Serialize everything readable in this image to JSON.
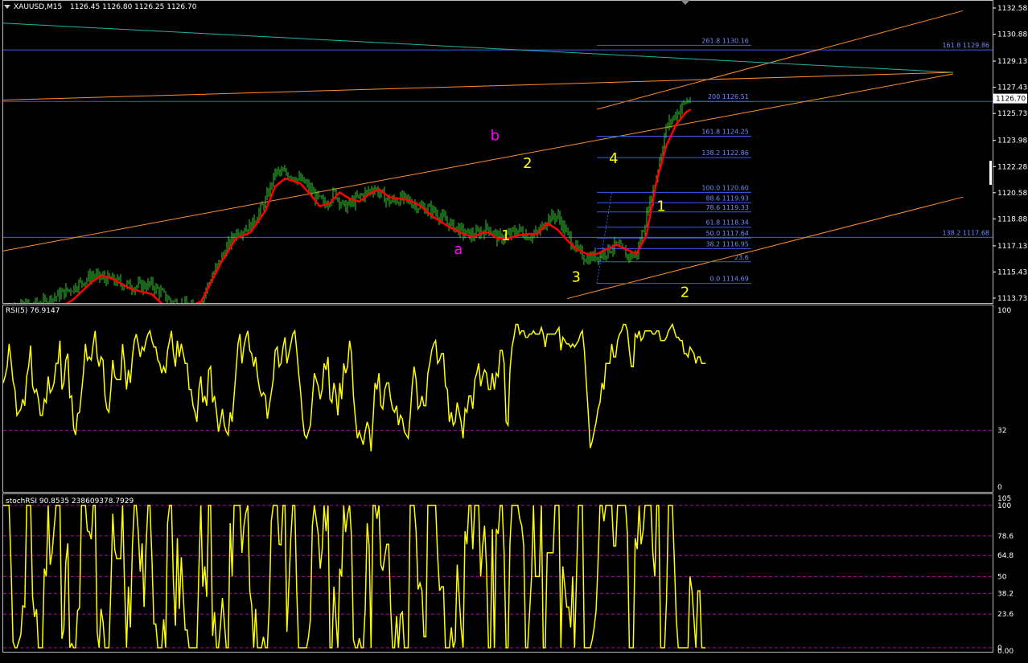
{
  "header": {
    "symbol_timeframe": "XAUUSD,M15",
    "ohlc": "1126.45 1126.80 1126.25 1126.70"
  },
  "colors": {
    "background": "#000000",
    "candles": "#32cd32",
    "ma": "#ff0000",
    "fib_levels": "#3b5bff",
    "trend_lines": "#ff8c2a",
    "channel_line": "#20b2aa",
    "rsi": "#ffff00",
    "wave_labels": "#ffff00",
    "abc_labels": "#ff00ff",
    "separator": "#ffffff",
    "level_lines": "#b000b0"
  },
  "chart_data": [
    {
      "type": "candlestick",
      "title": "XAUUSD,M15",
      "ylim": [
        1113.73,
        1132.58
      ],
      "y_ticks": [
        "1132.58",
        "1130.88",
        "1129.13",
        "1127.43",
        "1125.73",
        "1123.98",
        "1122.28",
        "1120.58",
        "1118.88",
        "1117.13",
        "1115.43",
        "1113.73"
      ],
      "current_price": "1126.70",
      "close_path": [
        [
          0.0,
          1113.0
        ],
        [
          0.04,
          1113.4
        ],
        [
          0.07,
          1114.4
        ],
        [
          0.09,
          1115.2
        ],
        [
          0.11,
          1114.9
        ],
        [
          0.13,
          1114.5
        ],
        [
          0.15,
          1114.6
        ],
        [
          0.17,
          1113.5
        ],
        [
          0.195,
          1113.0
        ],
        [
          0.205,
          1114.3
        ],
        [
          0.22,
          1116.3
        ],
        [
          0.235,
          1118.0
        ],
        [
          0.25,
          1118.4
        ],
        [
          0.265,
          1120.0
        ],
        [
          0.275,
          1121.9
        ],
        [
          0.29,
          1121.8
        ],
        [
          0.305,
          1121.2
        ],
        [
          0.315,
          1120.4
        ],
        [
          0.325,
          1119.8
        ],
        [
          0.335,
          1120.6
        ],
        [
          0.345,
          1119.6
        ],
        [
          0.36,
          1120.3
        ],
        [
          0.375,
          1120.9
        ],
        [
          0.39,
          1120.0
        ],
        [
          0.405,
          1120.2
        ],
        [
          0.42,
          1119.7
        ],
        [
          0.435,
          1119.4
        ],
        [
          0.45,
          1118.6
        ],
        [
          0.465,
          1118.0
        ],
        [
          0.475,
          1117.8
        ],
        [
          0.485,
          1118.1
        ],
        [
          0.49,
          1118.4
        ],
        [
          0.5,
          1117.6
        ],
        [
          0.51,
          1117.8
        ],
        [
          0.52,
          1118.2
        ],
        [
          0.53,
          1117.8
        ],
        [
          0.54,
          1117.9
        ],
        [
          0.55,
          1118.9
        ],
        [
          0.56,
          1119.1
        ],
        [
          0.57,
          1117.9
        ],
        [
          0.58,
          1116.8
        ],
        [
          0.59,
          1116.3
        ],
        [
          0.605,
          1116.6
        ],
        [
          0.62,
          1117.2
        ],
        [
          0.63,
          1116.5
        ],
        [
          0.64,
          1116.5
        ],
        [
          0.65,
          1119.0
        ],
        [
          0.66,
          1121.6
        ],
        [
          0.67,
          1124.8
        ],
        [
          0.68,
          1125.7
        ],
        [
          0.69,
          1126.5
        ],
        [
          0.695,
          1126.7
        ]
      ],
      "candle_noise_seed": 7,
      "ma_path": [
        [
          0.0,
          1111.5
        ],
        [
          0.04,
          1112.5
        ],
        [
          0.07,
          1113.6
        ],
        [
          0.09,
          1114.8
        ],
        [
          0.1,
          1115.2
        ],
        [
          0.11,
          1115.0
        ],
        [
          0.13,
          1114.3
        ],
        [
          0.15,
          1114.0
        ],
        [
          0.17,
          1112.8
        ],
        [
          0.2,
          1113.5
        ],
        [
          0.22,
          1116.0
        ],
        [
          0.235,
          1117.6
        ],
        [
          0.25,
          1118.0
        ],
        [
          0.265,
          1119.4
        ],
        [
          0.275,
          1121.0
        ],
        [
          0.285,
          1121.5
        ],
        [
          0.3,
          1121.2
        ],
        [
          0.31,
          1120.5
        ],
        [
          0.32,
          1119.7
        ],
        [
          0.33,
          1119.9
        ],
        [
          0.34,
          1120.6
        ],
        [
          0.35,
          1120.2
        ],
        [
          0.36,
          1120.0
        ],
        [
          0.37,
          1120.5
        ],
        [
          0.38,
          1120.8
        ],
        [
          0.39,
          1120.3
        ],
        [
          0.4,
          1120.2
        ],
        [
          0.41,
          1120.1
        ],
        [
          0.42,
          1119.8
        ],
        [
          0.435,
          1119.0
        ],
        [
          0.45,
          1118.4
        ],
        [
          0.465,
          1117.9
        ],
        [
          0.475,
          1117.7
        ],
        [
          0.485,
          1118.0
        ],
        [
          0.49,
          1118.0
        ],
        [
          0.5,
          1117.6
        ],
        [
          0.51,
          1117.6
        ],
        [
          0.52,
          1117.8
        ],
        [
          0.53,
          1117.9
        ],
        [
          0.54,
          1117.9
        ],
        [
          0.55,
          1118.6
        ],
        [
          0.56,
          1118.2
        ],
        [
          0.57,
          1117.5
        ],
        [
          0.58,
          1116.9
        ],
        [
          0.59,
          1116.6
        ],
        [
          0.6,
          1116.6
        ],
        [
          0.61,
          1116.9
        ],
        [
          0.62,
          1117.2
        ],
        [
          0.63,
          1116.9
        ],
        [
          0.64,
          1116.6
        ],
        [
          0.65,
          1117.8
        ],
        [
          0.66,
          1121.2
        ],
        [
          0.67,
          1123.6
        ],
        [
          0.68,
          1125.0
        ],
        [
          0.69,
          1125.8
        ],
        [
          0.695,
          1126.0
        ]
      ],
      "fib_retracement": {
        "x_start": 0.6,
        "x_end": 0.756,
        "levels": [
          {
            "label": "261.8 1130.16",
            "price": 1130.16
          },
          {
            "label": "200 1126.51",
            "price": 1126.51
          },
          {
            "label": "161.8 1124.25",
            "price": 1124.25
          },
          {
            "label": "138.2 1122.86",
            "price": 1122.86
          },
          {
            "label": "100.0 1120.60",
            "price": 1120.6
          },
          {
            "label": "88.6 1119.93",
            "price": 1119.93
          },
          {
            "label": "78.6 1119.33",
            "price": 1119.33
          },
          {
            "label": "61.8 1118.34",
            "price": 1118.34
          },
          {
            "label": "50.0 1117.64",
            "price": 1117.64
          },
          {
            "label": "38.2 1116.95",
            "price": 1116.95
          },
          {
            "label": "23.6",
            "price": 1116.09
          },
          {
            "label": "0.0 1114.69",
            "price": 1114.69
          }
        ]
      },
      "full_width_levels": [
        {
          "label": "161.8 1129.86",
          "price": 1129.86
        },
        {
          "label": "138.2 1117.68",
          "price": 1117.68
        },
        {
          "label": "",
          "price": 1126.51
        }
      ],
      "trend_lines": [
        {
          "kind": "orange",
          "from": [
            0.0,
            1116.8
          ],
          "to": [
            0.96,
            1128.3
          ]
        },
        {
          "kind": "orange",
          "from": [
            0.0,
            1126.6
          ],
          "to": [
            0.96,
            1128.4
          ]
        },
        {
          "kind": "orange",
          "from": [
            0.57,
            1113.7
          ],
          "to": [
            0.97,
            1120.3
          ]
        },
        {
          "kind": "orange",
          "from": [
            0.6,
            1126.0
          ],
          "to": [
            0.97,
            1132.4
          ]
        },
        {
          "kind": "teal",
          "from": [
            0.0,
            1131.6
          ],
          "to": [
            0.96,
            1128.4
          ]
        }
      ],
      "wave_labels": [
        {
          "text": "b",
          "x": 0.497,
          "price": 1124.0,
          "color": "abc"
        },
        {
          "text": "a",
          "x": 0.46,
          "price": 1116.6,
          "color": "abc"
        },
        {
          "text": "2",
          "x": 0.53,
          "price": 1122.2,
          "color": "wave"
        },
        {
          "text": "1",
          "x": 0.508,
          "price": 1117.5,
          "color": "wave"
        },
        {
          "text": "4",
          "x": 0.617,
          "price": 1122.5,
          "color": "wave"
        },
        {
          "text": "3",
          "x": 0.579,
          "price": 1114.8,
          "color": "wave"
        },
        {
          "text": "1",
          "x": 0.665,
          "price": 1119.4,
          "color": "wave"
        },
        {
          "text": "2",
          "x": 0.689,
          "price": 1113.8,
          "color": "wave"
        }
      ]
    },
    {
      "type": "line",
      "title": "RSI(5) 76.9147",
      "ylim": [
        0,
        100
      ],
      "y_ticks": [
        "100",
        "32",
        "0"
      ],
      "level_lines": [
        32
      ],
      "values": [
        64,
        68,
        74,
        88,
        78,
        65,
        60,
        44,
        46,
        48,
        54,
        50,
        68,
        74,
        87,
        62,
        58,
        60,
        54,
        44,
        44,
        54,
        52,
        68,
        58,
        60,
        64,
        76,
        76,
        90,
        60,
        64,
        78,
        82,
        55,
        56,
        36,
        32,
        45,
        46,
        58,
        70,
        88,
        78,
        80,
        78,
        88,
        96,
        80,
        74,
        80,
        78,
        56,
        48,
        46,
        60,
        78,
        68,
        66,
        66,
        66,
        88,
        76,
        60,
        72,
        64,
        80,
        90,
        94,
        88,
        80,
        86,
        84,
        90,
        94,
        96,
        90,
        86,
        86,
        78,
        76,
        70,
        74,
        70,
        84,
        90,
        96,
        82,
        74,
        90,
        80,
        88,
        82,
        76,
        76,
        60,
        60,
        50,
        46,
        40,
        60,
        68,
        52,
        56,
        50,
        72,
        74,
        52,
        56,
        46,
        34,
        40,
        48,
        38,
        34,
        32,
        46,
        40,
        56,
        72,
        88,
        94,
        76,
        86,
        92,
        96,
        84,
        82,
        74,
        80,
        68,
        60,
        56,
        58,
        56,
        42,
        50,
        58,
        66,
        84,
        86,
        74,
        76,
        86,
        92,
        76,
        82,
        88,
        94,
        96,
        84,
        70,
        58,
        42,
        32,
        30,
        34,
        38,
        54,
        70,
        66,
        62,
        54,
        60,
        76,
        72,
        80,
        54,
        52,
        64,
        58,
        44,
        64,
        54,
        76,
        70,
        74,
        90,
        82,
        56,
        42,
        30,
        34,
        30,
        26,
        34,
        40,
        36,
        22,
        42,
        64,
        60,
        70,
        50,
        48,
        60,
        64,
        64,
        54,
        48,
        46,
        50,
        38,
        44,
        42,
        34,
        32,
        30,
        44,
        62,
        74,
        66,
        48,
        50,
        56,
        50,
        50,
        70,
        76,
        84,
        88,
        90,
        76,
        78,
        82,
        82,
        62,
        60,
        40,
        46,
        38,
        40,
        52,
        46,
        40,
        30,
        48,
        46,
        56,
        56,
        48,
        66,
        70,
        76,
        62,
        68,
        72,
        70,
        60,
        60,
        70,
        60,
        70,
        68,
        84,
        84,
        76,
        40,
        38,
        72,
        86,
        92,
        100,
        100,
        94,
        96,
        96,
        92,
        92,
        94,
        94,
        96,
        94,
        94,
        94,
        98,
        94,
        86,
        94,
        94,
        94,
        94,
        94,
        96,
        98,
        84,
        92,
        90,
        88,
        88,
        86,
        88,
        86,
        88,
        90,
        94,
        96,
        84,
        64,
        46,
        24,
        28,
        34,
        40,
        48,
        52,
        64,
        60,
        76,
        76,
        76,
        88,
        80,
        80,
        90,
        94,
        96,
        100,
        100,
        96,
        84,
        74,
        74,
        94,
        92,
        96,
        90,
        92,
        96,
        96,
        96,
        96,
        94,
        94,
        96,
        96,
        90,
        90,
        90,
        92,
        96,
        98,
        100,
        96,
        92,
        92,
        90,
        90,
        82,
        82,
        80,
        86,
        84,
        82,
        76,
        80,
        80,
        76,
        76,
        76
      ]
    },
    {
      "type": "line",
      "title": "stochRSI 90.8535 238609378.7929",
      "ylim": [
        0,
        105
      ],
      "y_ticks": [
        "105",
        "100",
        "78.6",
        "64.8",
        "50",
        "38.2",
        "23.6",
        "0",
        "0.00"
      ],
      "level_lines": [
        100,
        78.6,
        64.8,
        50,
        38.2,
        23.6,
        0
      ]
    }
  ]
}
